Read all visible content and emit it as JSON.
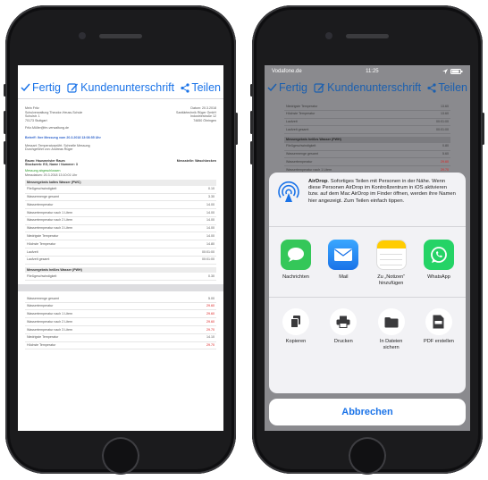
{
  "nav": {
    "done_label": "Fertig",
    "signature_label": "Kundenunterschrift",
    "share_label": "Teilen"
  },
  "doc": {
    "sender_name": "Mein Fritz",
    "sender_line1": "Schulverwaltung Theodor-Heuss-Schule",
    "sender_line2": "Schulstr. 1",
    "sender_line3": "70173 Stuttgart",
    "date_label": "Datum: 20.3.2018",
    "recipient_line1": "Sanitärtechnik Rüger GmbH",
    "recipient_line2": "Industriestraße 12",
    "recipient_line3": "74650 Öhringen",
    "email": "Fritz.Müller@fm-verwaltung.de",
    "subject": "Betreff: Ihre Messung vom 20.3.2018 13:08:55 Uhr",
    "body_line1": "Messart: Temperaturprüfrt. Schnelle Messung",
    "body_line2": "Durchgeführt von: Andreas Rüger",
    "room_label": "Raum: Hausmeister Raum",
    "room_point": "Messstelle: Waschbecken",
    "room_sub": "Stockwerk: EG, Name / Nummer: 3",
    "status_green": "Messung abgeschlossen",
    "measure_date": "Messdatum: 20.3.2018 13:10:01 Uhr",
    "section1": "Messergebnis kaltes Wasser (PWC)",
    "rows1": [
      {
        "label": "Fließgeschwindigkeit",
        "value": "0.10",
        "red": false
      },
      {
        "label": "Wassermenge gesamt",
        "value": "3.30",
        "red": false
      },
      {
        "label": "Wassertemperatur",
        "value": "14.00",
        "red": false
      },
      {
        "label": "Wassertemperatur nach 1 Litern",
        "value": "14.00",
        "red": false
      },
      {
        "label": "Wassertemperatur nach 2 Litern",
        "value": "14.00",
        "red": false
      },
      {
        "label": "Wassertemperatur nach 3 Litern",
        "value": "14.00",
        "red": false
      },
      {
        "label": "Niedrigste Temperatur",
        "value": "14.00",
        "red": false
      },
      {
        "label": "Höchste Temperatur",
        "value": "14.80",
        "red": false
      },
      {
        "label": "Laufzeit",
        "value": "00:01:00",
        "red": false
      },
      {
        "label": "Laufzeit gesamt",
        "value": "00:01:00",
        "red": false
      }
    ],
    "section2": "Messergebnis heißes Wasser (PWH)",
    "rows2": [
      {
        "label": "Fließgeschwindigkeit",
        "value": "0.30",
        "red": false
      }
    ],
    "rows3": [
      {
        "label": "Wassermenge gesamt",
        "value": "5.00",
        "red": false
      },
      {
        "label": "Wassertemperatur",
        "value": "29.60",
        "red": true
      },
      {
        "label": "Wassertemperatur nach 1 Litern",
        "value": "29.60",
        "red": true
      },
      {
        "label": "Wassertemperatur nach 2 Litern",
        "value": "29.60",
        "red": true
      },
      {
        "label": "Wassertemperatur nach 3 Litern",
        "value": "29.70",
        "red": true
      },
      {
        "label": "Niedrigste Temperatur",
        "value": "14.10",
        "red": false
      },
      {
        "label": "Höchste Temperatur",
        "value": "29.70",
        "red": true
      }
    ]
  },
  "right": {
    "carrier": "Vodafone.de",
    "time": "11:25",
    "behind_rows": [
      {
        "label": "Niedrigste Temperatur",
        "value": "13.60",
        "red": false
      },
      {
        "label": "Höchste Temperatur",
        "value": "13.60",
        "red": false
      },
      {
        "label": "Laufzeit",
        "value": "00:01:00",
        "red": false
      },
      {
        "label": "Laufzeit gesamt",
        "value": "00:01:00",
        "red": false
      }
    ],
    "behind_section": "Messergebnis heißes Wasser (PWH)",
    "behind_rows2": [
      {
        "label": "Fließgeschwindigkeit",
        "value": "0.80",
        "red": false
      },
      {
        "label": "Wassermenge gesamt",
        "value": "5.60",
        "red": false
      },
      {
        "label": "Wassertemperatur",
        "value": "29.60",
        "red": true
      },
      {
        "label": "Wassertemperatur nach 1 Litern",
        "value": "29.70",
        "red": true
      }
    ]
  },
  "share": {
    "airdrop_title": "AirDrop",
    "airdrop_text": ". Sofortiges Teilen mit Personen in der Nähe. Wenn diese Personen AirDrop im Kontrollzentrum in iOS aktivieren bzw. auf dem Mac AirDrop im Finder öffnen, werden ihre Namen hier angezeigt. Zum Teilen einfach tippen.",
    "apps": [
      {
        "label": "Nachrichten",
        "icon": "messages-icon"
      },
      {
        "label": "Mail",
        "icon": "mail-icon"
      },
      {
        "label": "Zu „Notizen“ hinzufügen",
        "icon": "notes-icon"
      },
      {
        "label": "WhatsApp",
        "icon": "whatsapp-icon"
      }
    ],
    "actions": [
      {
        "label": "Kopieren",
        "icon": "copy-icon"
      },
      {
        "label": "Drucken",
        "icon": "print-icon"
      },
      {
        "label": "In Dateien sichern",
        "icon": "folder-icon"
      },
      {
        "label": "PDF erstellen",
        "icon": "pdf-icon"
      }
    ],
    "cancel_label": "Abbrechen"
  },
  "colors": {
    "accent": "#1a73e8",
    "messages": "#34c759",
    "mail": "#1e90ff",
    "whatsapp": "#25d366",
    "alert_red": "#d22222"
  }
}
